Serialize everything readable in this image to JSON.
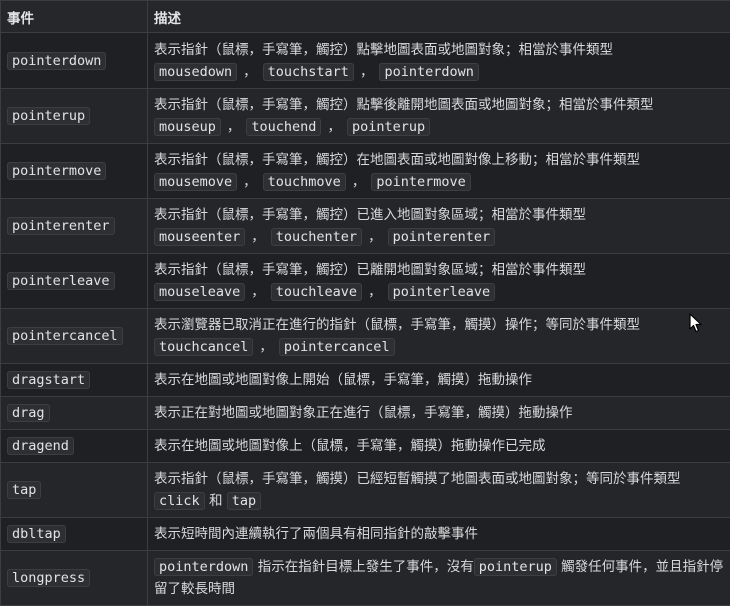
{
  "headers": {
    "event": "事件",
    "description": "描述"
  },
  "rows": [
    {
      "event": "pointerdown",
      "text": "表示指針（鼠標，手寫筆，觸控）點擊地圖表面或地圖對象；相當於事件類型",
      "codes": [
        "mousedown",
        "touchstart",
        "pointerdown"
      ]
    },
    {
      "event": "pointerup",
      "text": "表示指針（鼠標，手寫筆，觸控）點擊後離開地圖表面或地圖對象；相當於事件類型",
      "codes": [
        "mouseup",
        "touchend",
        "pointerup"
      ]
    },
    {
      "event": "pointermove",
      "text": "表示指針（鼠標，手寫筆，觸控）在地圖表面或地圖對像上移動；相當於事件類型",
      "codes": [
        "mousemove",
        "touchmove",
        "pointermove"
      ]
    },
    {
      "event": "pointerenter",
      "text": "表示指針（鼠標，手寫筆，觸控）已進入地圖對象區域；相當於事件類型",
      "codes": [
        "mouseenter",
        "touchenter",
        "pointerenter"
      ]
    },
    {
      "event": "pointerleave",
      "text": "表示指針（鼠標，手寫筆，觸控）已離開地圖對象區域；相當於事件類型",
      "codes": [
        "mouseleave",
        "touchleave",
        "pointerleave"
      ]
    },
    {
      "event": "pointercancel",
      "text": "表示瀏覽器已取消正在進行的指針（鼠標，手寫筆，觸摸）操作；等同於事件類型",
      "codes": [
        "touchcancel",
        "pointercancel"
      ]
    },
    {
      "event": "dragstart",
      "text": "表示在地圖或地圖對像上開始（鼠標，手寫筆，觸摸）拖動操作"
    },
    {
      "event": "drag",
      "text": "表示正在對地圖或地圖對象正在進行（鼠標，手寫筆，觸摸）拖動操作"
    },
    {
      "event": "dragend",
      "text": "表示在地圖或地圖對像上（鼠標，手寫筆，觸摸）拖動操作已完成"
    },
    {
      "event": "tap",
      "text": "表示指針（鼠標，手寫筆，觸摸）已經短暫觸摸了地圖表面或地圖對象；等同於事件類型",
      "code_a": "click",
      "joiner": "和",
      "code_b": "tap"
    },
    {
      "event": "dbltap",
      "text": "表示短時間內連續執行了兩個具有相同指針的敲擊事件"
    },
    {
      "event": "longpress",
      "code_a": "pointerdown",
      "text_a": "指示在指針目標上發生了事件，沒有",
      "code_b": "pointerup",
      "text_b": "觸發任何事件，並且指針停留了較長時間"
    }
  ],
  "separator": "，",
  "icons": {
    "cursor": "mouse-pointer-icon"
  }
}
